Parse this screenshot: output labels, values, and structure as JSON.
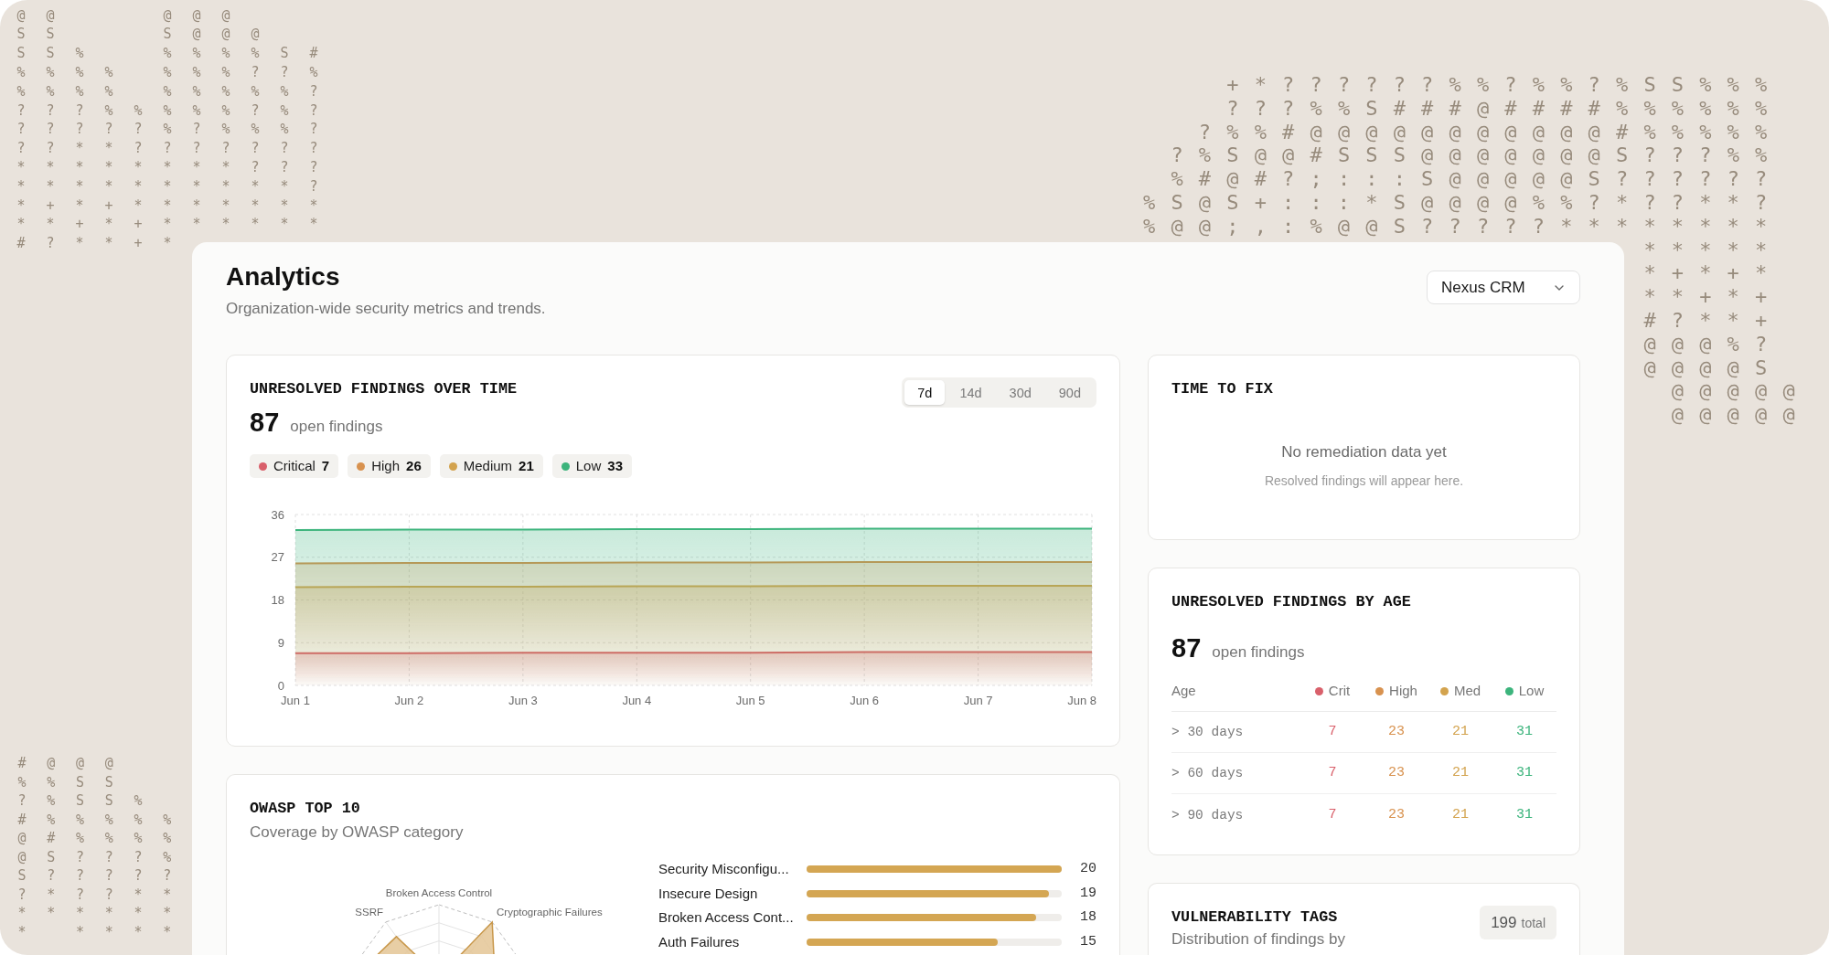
{
  "backdrop_art": {
    "top_left": [
      "@ @       @ @ @",
      "S S       S @ @ @",
      "S S %     % % % % S #",
      "% % % %   % % % ? ? %",
      "% % % %   % % % % % ?",
      "? ? ? % % % % % ? % ?",
      "? ? ? ? ? % ? % % % ?",
      "? ? * * ? ? ? ? ? ? ?",
      "* * * * * * * * ? ? ?",
      "* * * * * * * * * * ?",
      "* + * + * * * * * * *",
      "* * + * + * * * * * *",
      "# ? * * + *"
    ],
    "top_right": [
      "      + * ? ? ? ? ? ? % % ? % % ? % S S % % %",
      "      ? ? ? % % S # # # @ # # # # % % % % % %",
      "    ? % % # @ @ @ @ @ @ @ @ @ @ @ # % % % % %",
      "  ? % S @ @ # S S S @ @ @ @ @ @ @ S ? ? ? % %",
      "  % # @ # ? ; : : : S @ @ @ @ @ S ? ? ? ? ? ?",
      "% S @ S + : : : * S @ @ @ @ % % ? * ? ? * * ?",
      "% @ @ ; , : % @ @ S ? ? ? ? ? * * * * * * * *",
      "                                    * * * * *",
      "                                    * + * + *",
      "                                    * * + * +",
      "                                    # ? * * +",
      "                                    @ @ @ % ?",
      "                                    @ @ @ @ S",
      "                                      @ @ @ @ @",
      "                                      @ @ @ @ @"
    ],
    "bottom_left": [
      "# @ @ @",
      "% % S S",
      "? % S S %",
      "# % % % % %",
      "@ # % % % %",
      "@ S ? ? ? %",
      "S ? ? ? ? ?",
      "? * ? ? * *",
      "* * * * * *",
      "*   * * * *"
    ]
  },
  "header": {
    "title": "Analytics",
    "subtitle": "Organization-wide security metrics and trends.",
    "project_select": {
      "value": "Nexus CRM"
    }
  },
  "findings_over_time": {
    "title": "UNRESOLVED FINDINGS OVER TIME",
    "count": "87",
    "count_label": "open findings",
    "ranges": [
      {
        "label": "7d",
        "selected": true
      },
      {
        "label": "14d",
        "selected": false
      },
      {
        "label": "30d",
        "selected": false
      },
      {
        "label": "90d",
        "selected": false
      }
    ],
    "legend": [
      {
        "count": "7"
      },
      {
        "count": "26"
      },
      {
        "count": "21"
      },
      {
        "count": "33"
      }
    ],
    "chart_data": {
      "type": "area",
      "categories": [
        "Jun 1",
        "Jun 2",
        "Jun 3",
        "Jun 4",
        "Jun 5",
        "Jun 6",
        "Jun 7",
        "Jun 8"
      ],
      "series": [
        {
          "name": "Critical",
          "color": "#d9606b",
          "values": [
            6.8,
            6.8,
            6.9,
            6.9,
            6.9,
            7,
            7,
            7
          ]
        },
        {
          "name": "High",
          "color": "#d8924f",
          "values": [
            25.7,
            25.8,
            25.8,
            25.9,
            25.9,
            26,
            26,
            26
          ]
        },
        {
          "name": "Medium",
          "color": "#d3a34e",
          "values": [
            20.7,
            20.8,
            20.8,
            20.9,
            20.9,
            21,
            21,
            21
          ]
        },
        {
          "name": "Low",
          "color": "#3cb47c",
          "values": [
            32.7,
            32.8,
            32.8,
            32.9,
            32.9,
            33,
            33,
            33
          ]
        }
      ],
      "ylim": [
        0,
        36
      ],
      "yticks": [
        0,
        9,
        18,
        27,
        36
      ],
      "grid": true
    }
  },
  "time_to_fix": {
    "title": "TIME TO FIX",
    "empty_title": "No remediation data yet",
    "empty_hint": "Resolved findings will appear here."
  },
  "findings_by_age": {
    "title": "UNRESOLVED FINDINGS BY AGE",
    "count": "87",
    "count_label": "open findings",
    "columns": [
      {
        "label": "Age"
      },
      {
        "label": "Crit",
        "color": "#d9606b"
      },
      {
        "label": "High",
        "color": "#d8924f"
      },
      {
        "label": "Med",
        "color": "#d3a34e"
      },
      {
        "label": "Low",
        "color": "#3cb47c"
      }
    ],
    "rows": [
      {
        "age": "> 30 days",
        "counts": [
          "7",
          "23",
          "21",
          "31"
        ]
      },
      {
        "age": "> 60 days",
        "counts": [
          "7",
          "23",
          "21",
          "31"
        ]
      },
      {
        "age": "> 90 days",
        "counts": [
          "7",
          "23",
          "21",
          "31"
        ]
      }
    ]
  },
  "owasp_top_10": {
    "title": "OWASP TOP 10",
    "subtitle": "Coverage by OWASP category",
    "radar_labels": [
      "Broken Access Control",
      "SSRF",
      "Cryptographic Failures"
    ],
    "bars": [
      {
        "label": "Security Misconfigu...",
        "value": "20",
        "level": 1
      },
      {
        "label": "Insecure Design",
        "value": "19",
        "level": 0.95
      },
      {
        "label": "Broken Access Cont...",
        "value": "18",
        "level": 0.9
      },
      {
        "label": "Auth Failures",
        "value": "15",
        "level": 0.75
      }
    ]
  },
  "vulnerability_tags": {
    "title": "VULNERABILITY TAGS",
    "subtitle": "Distribution of findings by",
    "total": "199",
    "total_label": "total"
  }
}
